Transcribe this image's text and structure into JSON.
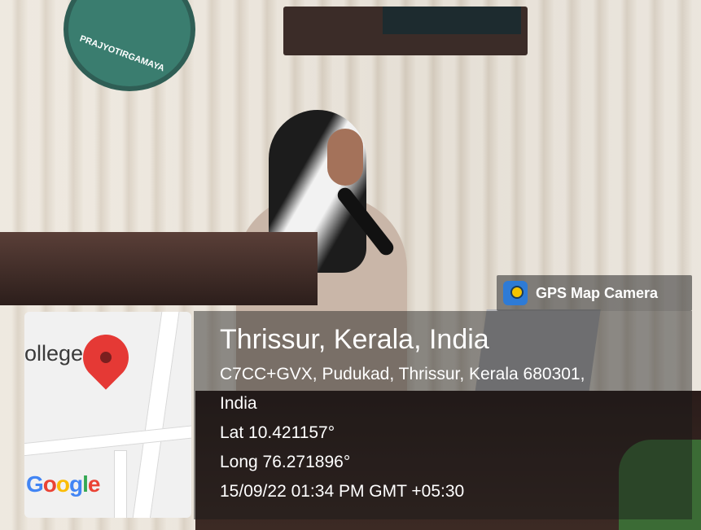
{
  "badge": {
    "app_name": "GPS Map Camera",
    "icon": "gps-map-camera-icon"
  },
  "map": {
    "label": "ollege",
    "attribution": [
      "G",
      "o",
      "o",
      "g",
      "l",
      "e"
    ],
    "pin_icon": "map-pin-icon"
  },
  "location": {
    "title": "Thrissur, Kerala, India",
    "address_line1": "C7CC+GVX, Pudukad, Thrissur, Kerala 680301,",
    "address_line2": "India",
    "lat": "Lat 10.421157°",
    "long": "Long 76.271896°",
    "datetime": "15/09/22 01:34 PM GMT +05:30"
  },
  "scene": {
    "logo_text": "PRAJYOTIRGAMAYA"
  }
}
